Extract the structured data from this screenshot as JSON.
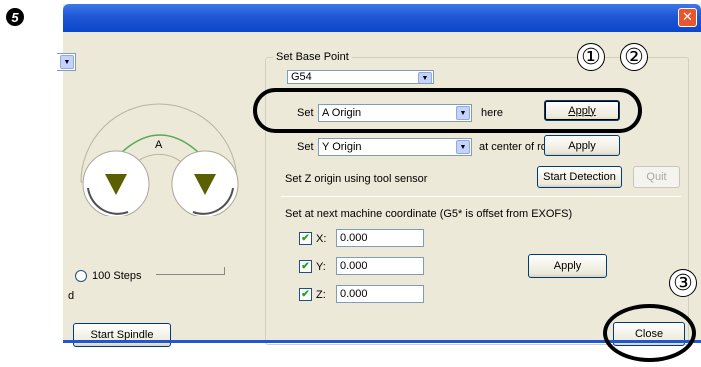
{
  "step_number": "5",
  "window": {
    "close_glyph": "✕"
  },
  "left_panel": {
    "jog_label": "A",
    "radio_100_steps": "100 Steps",
    "partial_label": "d",
    "start_spindle": "Start Spindle"
  },
  "base_point": {
    "group_title": "Set Base Point",
    "work_coord_value": "G54",
    "set_label": "Set",
    "a_origin_value": "A Origin",
    "here_label": "here",
    "apply_label": "Apply",
    "y_origin_value": "Y Origin",
    "center_rotation_label": "at center of rotation",
    "z_sensor_label": "Set Z origin using tool sensor",
    "start_detection": "Start Detection",
    "quit": "Quit"
  },
  "machine_coords": {
    "header": "Set at next machine coordinate  (G5* is offset from EXOFS)",
    "rows": [
      {
        "axis": "X:",
        "checked": true,
        "value": "0.000"
      },
      {
        "axis": "Y:",
        "checked": true,
        "value": "0.000"
      },
      {
        "axis": "Z:",
        "checked": true,
        "value": "0.000"
      }
    ],
    "apply_label": "Apply"
  },
  "close_label": "Close",
  "callouts": [
    "①",
    "②",
    "③"
  ],
  "check_mark": "✔",
  "dropdown_arrow": "▼",
  "icons": [
    "close-icon",
    "down-arrow-icon",
    "check-icon",
    "jog-down-icon"
  ]
}
